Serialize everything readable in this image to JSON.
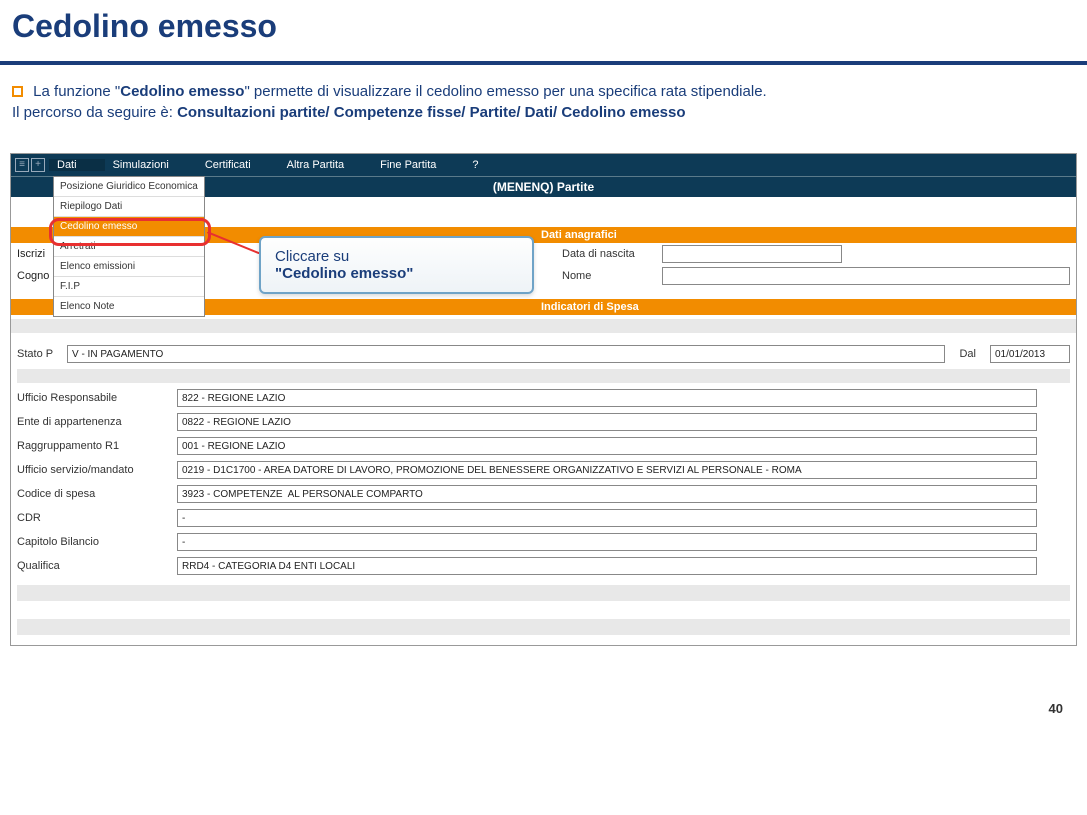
{
  "page": {
    "title": "Cedolino emesso",
    "number": "40"
  },
  "intro": {
    "line1a": "La funzione \"",
    "line1b": "Cedolino emesso",
    "line1c": "\" permette di visualizzare il cedolino emesso per una specifica rata stipendiale.",
    "line2a": "Il percorso da seguire è: ",
    "line2b": "Consultazioni partite/ Competenze fisse/ Partite/ Dati/ Cedolino emesso"
  },
  "menubar": {
    "items": [
      "Dati",
      "Simulazioni",
      "Certificati",
      "Altra Partita",
      "Fine Partita",
      "?"
    ]
  },
  "subbar": "(MENENQ) Partite",
  "dropdown": {
    "items": [
      {
        "label": "Posizione Giuridico Economica"
      },
      {
        "label": "Riepilogo Dati"
      },
      {
        "label": "Cedolino emesso",
        "hl": true
      },
      {
        "label": "Arretrati"
      },
      {
        "label": "Elenco emissioni"
      },
      {
        "label": "F.I.P"
      },
      {
        "label": "Elenco Note"
      }
    ]
  },
  "callout": {
    "line1": "Cliccare su",
    "line2": "\"Cedolino emesso\""
  },
  "sections": {
    "anag": "Dati anagrafici",
    "spesa": "Indicatori di Spesa"
  },
  "anag": {
    "l1": "Data di nascita",
    "l2": "Nome"
  },
  "bglabels": {
    "iscr": "Iscrizi",
    "cogn": "Cogno"
  },
  "fields": {
    "stato_p_label": "Stato P",
    "stato_p_value": "V - IN PAGAMENTO",
    "dal_label": "Dal",
    "dal_value": "01/01/2013",
    "uff_resp_label": "Ufficio Responsabile",
    "uff_resp_value": "822 - REGIONE LAZIO",
    "ente_label": "Ente di appartenenza",
    "ente_value": "0822 - REGIONE LAZIO",
    "ragg_label": "Raggruppamento R1",
    "ragg_value": "001 - REGIONE LAZIO",
    "uff_serv_label": "Ufficio servizio/mandato",
    "uff_serv_value": "0219 - D1C1700 - AREA DATORE DI LAVORO, PROMOZIONE DEL BENESSERE ORGANIZZATIVO E SERVIZI AL PERSONALE - ROMA",
    "cod_spesa_label": "Codice di spesa",
    "cod_spesa_value": "3923 - COMPETENZE  AL PERSONALE COMPARTO",
    "cdr_label": "CDR",
    "cdr_value": "-",
    "cap_label": "Capitolo Bilancio",
    "cap_value": "-",
    "qual_label": "Qualifica",
    "qual_value": "RRD4 - CATEGORIA D4 ENTI LOCALI"
  }
}
